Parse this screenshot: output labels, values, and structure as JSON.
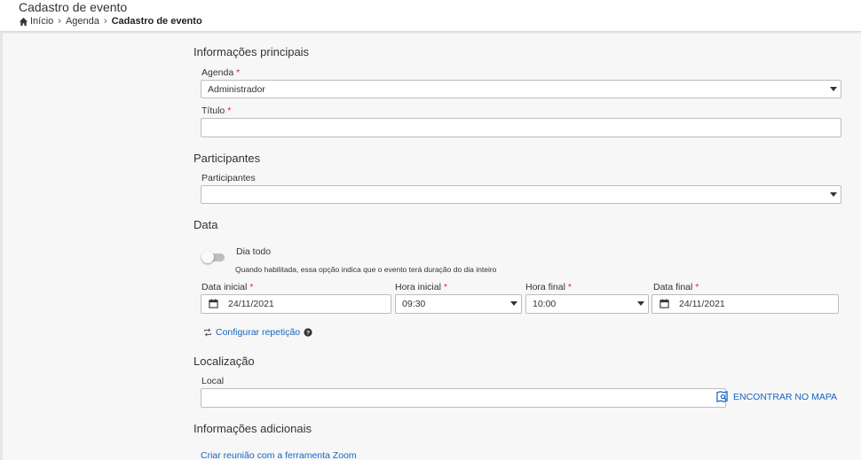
{
  "header": {
    "title": "Cadastro de evento",
    "breadcrumb": {
      "home": "Início",
      "middle": "Agenda",
      "current": "Cadastro de evento"
    }
  },
  "main_info": {
    "section_title": "Informações principais",
    "agenda_label": "Agenda",
    "agenda_value": "Administrador",
    "titulo_label": "Título",
    "titulo_value": ""
  },
  "participants": {
    "section_title": "Participantes",
    "label": "Participantes",
    "value": ""
  },
  "date": {
    "section_title": "Data",
    "all_day_label": "Dia todo",
    "all_day_enabled": false,
    "all_day_hint": "Quando habilitada, essa opção indica que o evento terá duração do dia inteiro",
    "start_date_label": "Data inicial",
    "start_date": "24/11/2021",
    "start_time_label": "Hora inicial",
    "start_time": "09:30",
    "end_time_label": "Hora final",
    "end_time": "10:00",
    "end_date_label": "Data final",
    "end_date": "24/11/2021",
    "repeat_link": "Configurar repetição"
  },
  "location": {
    "section_title": "Localização",
    "local_label": "Local",
    "local_value": "",
    "map_button": "ENCONTRAR NO MAPA"
  },
  "additional": {
    "section_title": "Informações adicionais",
    "zoom_link": "Criar reunião com a ferramenta Zoom"
  },
  "required_marker": "*",
  "colors": {
    "link": "#1565c0",
    "required": "#d32f2f"
  }
}
